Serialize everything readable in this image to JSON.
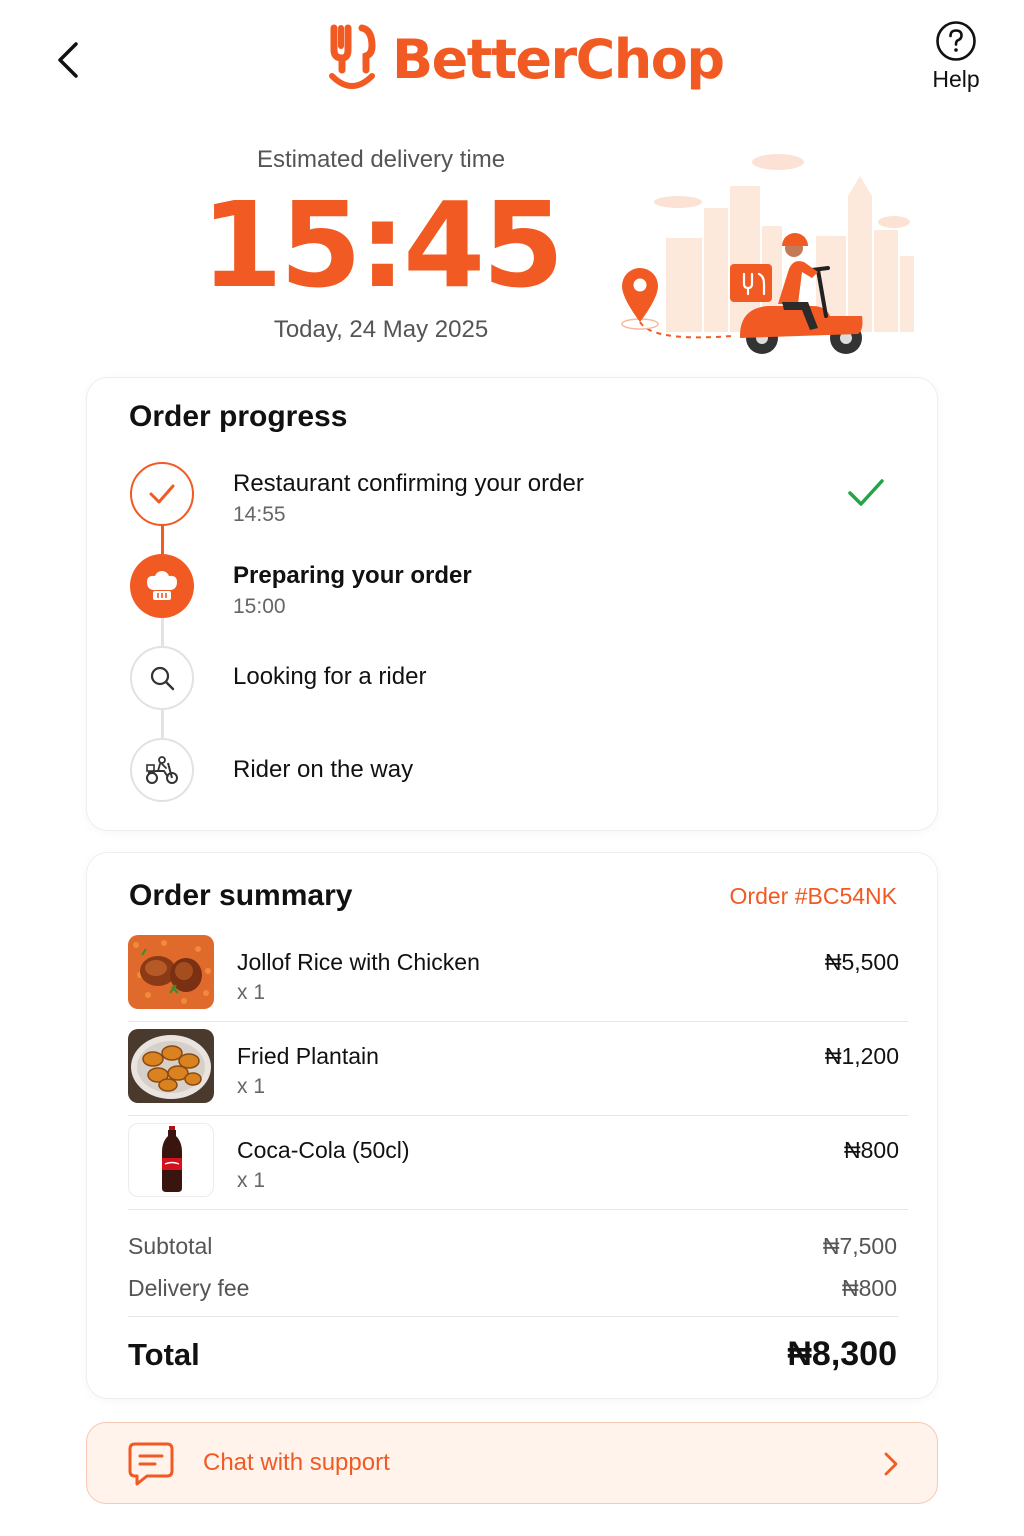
{
  "header": {
    "brand": "BetterChop",
    "help_label": "Help",
    "icons": {
      "back": "chevron-left-icon",
      "logo": "fork-smile-logo",
      "help": "question-circle-icon"
    }
  },
  "eta": {
    "label": "Estimated delivery time",
    "time": "15:45",
    "date": "Today, 24 May 2025"
  },
  "progress": {
    "title": "Order progress",
    "steps": [
      {
        "title": "Restaurant confirming your order",
        "time": "14:55",
        "status": "done",
        "icon": "check-icon"
      },
      {
        "title": "Preparing your order",
        "time": "15:00",
        "status": "current",
        "icon": "chef-hat-icon"
      },
      {
        "title": "Looking for a rider",
        "time": "",
        "status": "pending",
        "icon": "search-icon"
      },
      {
        "title": "Rider on the way",
        "time": "",
        "status": "pending",
        "icon": "scooter-icon"
      }
    ]
  },
  "summary": {
    "title": "Order summary",
    "order_id": "Order #BC54NK",
    "items": [
      {
        "name": "Jollof Rice with Chicken",
        "qty": "x 1",
        "price": "₦5,500"
      },
      {
        "name": "Fried Plantain",
        "qty": "x 1",
        "price": "₦1,200"
      },
      {
        "name": "Coca-Cola (50cl)",
        "qty": "x 1",
        "price": "₦800"
      }
    ],
    "subtotal_label": "Subtotal",
    "subtotal": "₦7,500",
    "delivery_label": "Delivery fee",
    "delivery": "₦800",
    "total_label": "Total",
    "total": "₦8,300"
  },
  "support": {
    "label": "Chat with support",
    "icon": "chat-bubble-icon"
  },
  "colors": {
    "brand": "#f15a22",
    "success": "#22a447",
    "support_bg": "#fff3ec"
  }
}
